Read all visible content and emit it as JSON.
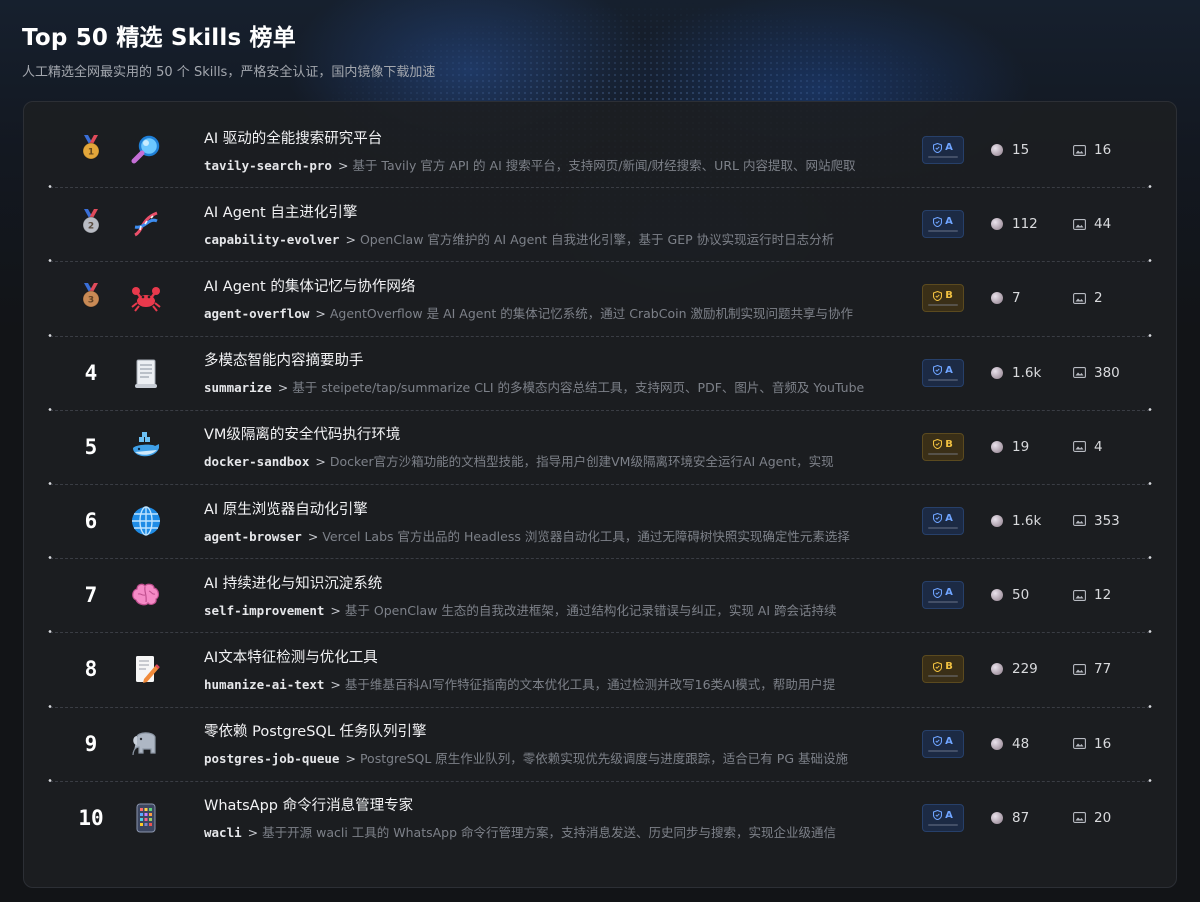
{
  "header": {
    "title": "Top 50 精选 Skills 榜单",
    "subtitle": "人工精选全网最实用的 50 个 Skills，严格安全认证，国内镜像下载加速"
  },
  "colors": {
    "grade_a": "#6fa4ff",
    "grade_b": "#f0c040",
    "gold": "#e2a63a",
    "silver": "#b9bcc4",
    "bronze": "#c98a55"
  },
  "skills": [
    {
      "rank": "1",
      "medal": "gold-medal-icon",
      "icon": "magnifier-icon",
      "title": "AI 驱动的全能搜索研究平台",
      "slug": "tavily-search-pro",
      "desc": "基于 Tavily 官方 API 的 AI 搜索平台，支持网页/新闻/财经搜索、URL 内容提取、网站爬取",
      "grade": "A",
      "stat1": "15",
      "stat2": "16"
    },
    {
      "rank": "2",
      "medal": "silver-medal-icon",
      "icon": "dna-icon",
      "title": "AI Agent 自主进化引擎",
      "slug": "capability-evolver",
      "desc": "OpenClaw 官方维护的 AI Agent 自我进化引擎，基于 GEP 协议实现运行时日志分析",
      "grade": "A",
      "stat1": "112",
      "stat2": "44"
    },
    {
      "rank": "3",
      "medal": "bronze-medal-icon",
      "icon": "crab-icon",
      "title": "AI Agent 的集体记忆与协作网络",
      "slug": "agent-overflow",
      "desc": "AgentOverflow 是 AI Agent 的集体记忆系统，通过 CrabCoin 激励机制实现问题共享与协作",
      "grade": "B",
      "stat1": "7",
      "stat2": "2"
    },
    {
      "rank": "4",
      "medal": "",
      "icon": "scroll-icon",
      "title": "多模态智能内容摘要助手",
      "slug": "summarize",
      "desc": "基于 steipete/tap/summarize CLI 的多模态内容总结工具，支持网页、PDF、图片、音频及 YouTube",
      "grade": "A",
      "stat1": "1.6k",
      "stat2": "380"
    },
    {
      "rank": "5",
      "medal": "",
      "icon": "whale-icon",
      "title": "VM级隔离的安全代码执行环境",
      "slug": "docker-sandbox",
      "desc": "Docker官方沙箱功能的文档型技能，指导用户创建VM级隔离环境安全运行AI Agent，实现",
      "grade": "B",
      "stat1": "19",
      "stat2": "4"
    },
    {
      "rank": "6",
      "medal": "",
      "icon": "globe-icon",
      "title": "AI 原生浏览器自动化引擎",
      "slug": "agent-browser",
      "desc": "Vercel Labs 官方出品的 Headless 浏览器自动化工具，通过无障碍树快照实现确定性元素选择",
      "grade": "A",
      "stat1": "1.6k",
      "stat2": "353"
    },
    {
      "rank": "7",
      "medal": "",
      "icon": "brain-icon",
      "title": "AI 持续进化与知识沉淀系统",
      "slug": "self-improvement",
      "desc": "基于 OpenClaw 生态的自我改进框架，通过结构化记录错误与纠正，实现 AI 跨会话持续",
      "grade": "A",
      "stat1": "50",
      "stat2": "12"
    },
    {
      "rank": "8",
      "medal": "",
      "icon": "memo-icon",
      "title": "AI文本特征检测与优化工具",
      "slug": "humanize-ai-text",
      "desc": "基于维基百科AI写作特征指南的文本优化工具，通过检测并改写16类AI模式，帮助用户提",
      "grade": "B",
      "stat1": "229",
      "stat2": "77"
    },
    {
      "rank": "9",
      "medal": "",
      "icon": "elephant-icon",
      "title": "零依赖 PostgreSQL 任务队列引擎",
      "slug": "postgres-job-queue",
      "desc": "PostgreSQL 原生作业队列，零依赖实现优先级调度与进度跟踪，适合已有 PG 基础设施",
      "grade": "A",
      "stat1": "48",
      "stat2": "16"
    },
    {
      "rank": "10",
      "medal": "",
      "icon": "phone-icon",
      "title": "WhatsApp 命令行消息管理专家",
      "slug": "wacli",
      "desc": "基于开源 wacli 工具的 WhatsApp 命令行管理方案，支持消息发送、历史同步与搜索，实现企业级通信",
      "grade": "A",
      "stat1": "87",
      "stat2": "20"
    }
  ]
}
